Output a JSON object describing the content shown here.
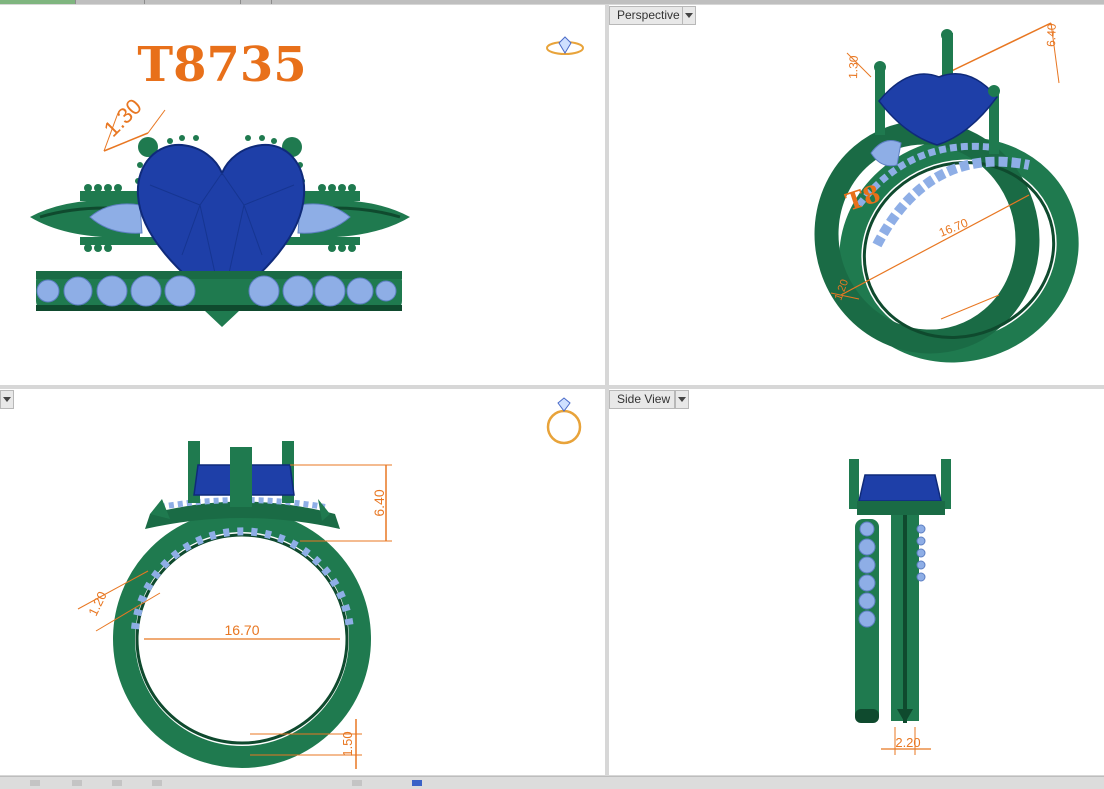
{
  "viewports": {
    "front": {
      "label": "",
      "title": "T8735",
      "dimension": "1.30"
    },
    "perspective": {
      "label": "Perspective",
      "dimensions": {
        "height": "6.40",
        "prong": "1.30",
        "inner": "16.70",
        "band": "1.20"
      },
      "title_fragment": "T8"
    },
    "top": {
      "label": "",
      "dimensions": {
        "height": "6.40",
        "band": "1.20",
        "inner": "16.70",
        "shank": "1.50"
      }
    },
    "side": {
      "label": "Side View",
      "dimensions": {
        "width": "2.20"
      }
    }
  },
  "icons": {
    "view_cube_front": "ring-front-icon",
    "view_cube_top": "ring-top-icon"
  },
  "colors": {
    "metal": "#1f7a4f",
    "metal_dark": "#0f4a2e",
    "center_stone": "#1e3fa8",
    "side_stones": "#8eaee6",
    "dimension": "#e87722",
    "title": "#e8701a"
  }
}
